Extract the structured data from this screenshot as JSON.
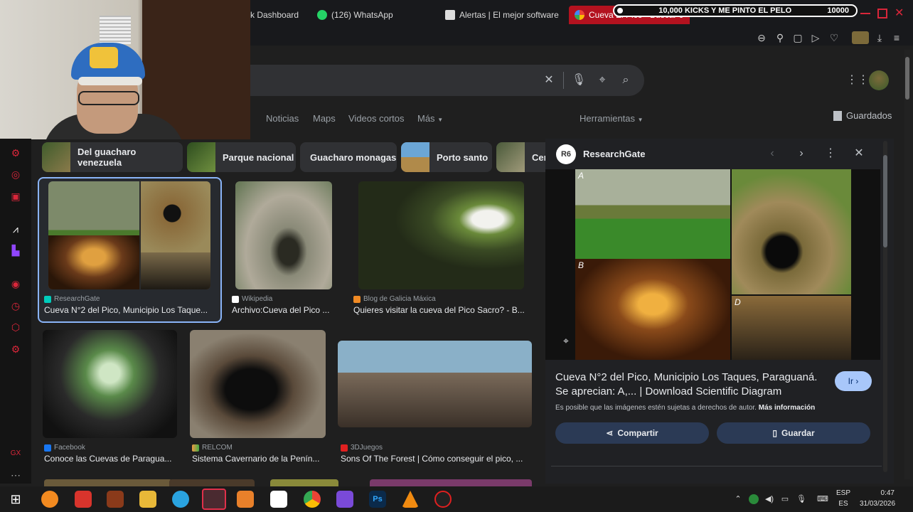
{
  "browser": {
    "tabs": [
      {
        "label": "k Dashboard"
      },
      {
        "label": "(126) WhatsApp"
      },
      {
        "label": "Alertas | El mejor software"
      },
      {
        "label": "Cueva El Pico - Buscar c"
      }
    ],
    "stream_banner": {
      "goal": "10,000 KICKS Y ME PINTO EL PELO",
      "target": "10000"
    }
  },
  "search": {
    "nav_tabs": [
      "Noticias",
      "Maps",
      "Videos cortos",
      "Más"
    ],
    "tools": "Herramientas",
    "saved": "Guardados",
    "chips": [
      "Del guacharo venezuela",
      "Parque nacional",
      "Guacharo monagas",
      "Porto santo",
      "Cer"
    ]
  },
  "results": [
    {
      "source": "ResearchGate",
      "caption": "Cueva N°2 del Pico, Municipio Los Taque..."
    },
    {
      "source": "Wikipedia",
      "caption": "Archivo:Cueva del Pico ..."
    },
    {
      "source": "Blog de Galicia Máxica",
      "caption": "Quieres visitar la cueva del Pico Sacro? - B..."
    },
    {
      "source": "Facebook",
      "caption": "Conoce las Cuevas de Paragua..."
    },
    {
      "source": "RELCOM",
      "caption": "Sistema Cavernario de la Penín..."
    },
    {
      "source": "3DJuegos",
      "caption": "Sons Of The Forest | Cómo conseguir el pico, ..."
    }
  ],
  "preview": {
    "logo_text": "R6",
    "source": "ResearchGate",
    "title": "Cueva N°2 del Pico, Municipio Los Taques, Paraguaná. Se aprecian: A,... | Download Scientific Diagram",
    "visit_label": "Ir ›",
    "copyright": "Es posible que las imágenes estén sujetas a derechos de autor.",
    "more_info": "Más información",
    "share_label": "Compartir",
    "save_label": "Guardar",
    "image_labels": [
      "A",
      "B",
      "D"
    ]
  },
  "taskbar": {
    "lang_top": "ESP",
    "lang_bottom": "ES",
    "time": "0:47",
    "date": "31/03/2026"
  },
  "colors": {
    "accent": "#8ab4f8",
    "tab_active": "#b3121f",
    "opera_red": "#d9263a"
  }
}
